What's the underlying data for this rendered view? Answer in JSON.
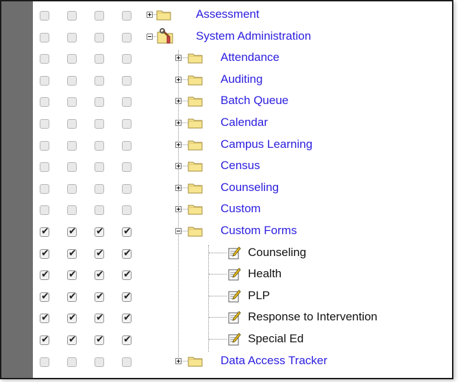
{
  "tree": {
    "items": [
      {
        "label": "Assessment",
        "type": "folder",
        "toggle": "plus",
        "level": 1,
        "checks": [
          false,
          false,
          false,
          false
        ]
      },
      {
        "label": "System Administration",
        "type": "gear",
        "toggle": "minus",
        "level": 1,
        "checks": [
          false,
          false,
          false,
          false
        ]
      },
      {
        "label": "Attendance",
        "type": "folder",
        "toggle": "plus",
        "level": 2,
        "checks": [
          false,
          false,
          false,
          false
        ]
      },
      {
        "label": "Auditing",
        "type": "folder",
        "toggle": "plus",
        "level": 2,
        "checks": [
          false,
          false,
          false,
          false
        ]
      },
      {
        "label": "Batch Queue",
        "type": "folder",
        "toggle": "plus",
        "level": 2,
        "checks": [
          false,
          false,
          false,
          false
        ]
      },
      {
        "label": "Calendar",
        "type": "folder",
        "toggle": "plus",
        "level": 2,
        "checks": [
          false,
          false,
          false,
          false
        ]
      },
      {
        "label": "Campus Learning",
        "type": "folder",
        "toggle": "plus",
        "level": 2,
        "checks": [
          false,
          false,
          false,
          false
        ]
      },
      {
        "label": "Census",
        "type": "folder",
        "toggle": "plus",
        "level": 2,
        "checks": [
          false,
          false,
          false,
          false
        ]
      },
      {
        "label": "Counseling",
        "type": "folder",
        "toggle": "plus",
        "level": 2,
        "checks": [
          false,
          false,
          false,
          false
        ]
      },
      {
        "label": "Custom",
        "type": "folder",
        "toggle": "plus",
        "level": 2,
        "checks": [
          false,
          false,
          false,
          false
        ]
      },
      {
        "label": "Custom Forms",
        "type": "folder",
        "toggle": "minus",
        "level": 2,
        "checks": [
          true,
          true,
          true,
          true
        ]
      },
      {
        "label": "Counseling",
        "type": "form",
        "toggle": "none",
        "level": 3,
        "checks": [
          true,
          true,
          true,
          true
        ]
      },
      {
        "label": "Health",
        "type": "form",
        "toggle": "none",
        "level": 3,
        "checks": [
          true,
          true,
          true,
          true
        ]
      },
      {
        "label": "PLP",
        "type": "form",
        "toggle": "none",
        "level": 3,
        "checks": [
          true,
          true,
          true,
          true
        ]
      },
      {
        "label": "Response to Intervention",
        "type": "form",
        "toggle": "none",
        "level": 3,
        "checks": [
          true,
          true,
          true,
          true
        ]
      },
      {
        "label": "Special Ed",
        "type": "form",
        "toggle": "none",
        "level": 3,
        "checks": [
          true,
          true,
          true,
          true
        ]
      },
      {
        "label": "Data Access Tracker",
        "type": "folder",
        "toggle": "plus",
        "level": 2,
        "checks": [
          false,
          false,
          false,
          false
        ]
      }
    ]
  },
  "colors": {
    "link": "#2b1dde",
    "sidebar": "#6e6e6e",
    "folder_fill": "#f7e58f",
    "folder_stroke": "#a08a3a"
  },
  "icons": {
    "folder": "folder-icon",
    "gear": "system-admin-tools-icon",
    "form": "custom-form-icon",
    "check": "✔"
  }
}
